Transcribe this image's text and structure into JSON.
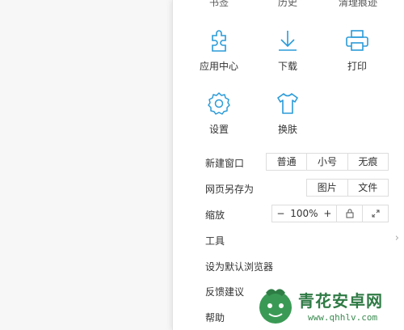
{
  "top_labels": [
    "书签",
    "历史",
    "清理痕迹"
  ],
  "grid": {
    "app_center": "应用中心",
    "download": "下载",
    "print": "打印",
    "settings": "设置",
    "skin": "换肤"
  },
  "new_window": {
    "label": "新建窗口",
    "options": [
      "普通",
      "小号",
      "无痕"
    ]
  },
  "save_as": {
    "label": "网页另存为",
    "options": [
      "图片",
      "文件"
    ]
  },
  "zoom": {
    "label": "缩放",
    "minus": "−",
    "value": "100%",
    "plus": "+"
  },
  "tools": {
    "label": "工具",
    "chevron": "›"
  },
  "set_default": {
    "label": "设为默认浏览器"
  },
  "feedback": {
    "label": "反馈建议"
  },
  "help": {
    "label": "帮助"
  },
  "watermark": {
    "name": "青花安卓网",
    "url": "www.qhhlv.com"
  },
  "colors": {
    "accent": "#2a9bd8",
    "watermark": "#2f7a45"
  }
}
